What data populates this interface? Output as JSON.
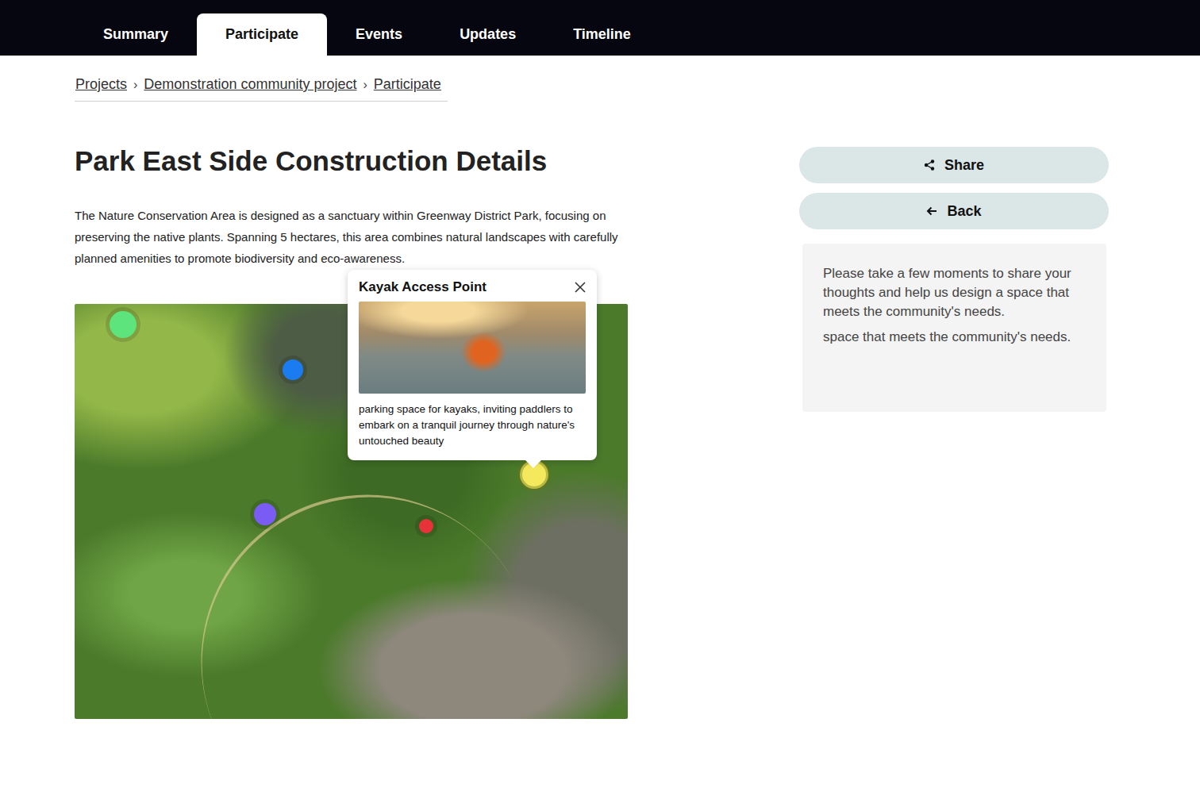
{
  "nav": {
    "tabs": [
      {
        "label": "Summary",
        "selected": false
      },
      {
        "label": "Participate",
        "selected": true
      },
      {
        "label": "Events",
        "selected": false
      },
      {
        "label": "Updates",
        "selected": false
      },
      {
        "label": "Timeline",
        "selected": false
      }
    ]
  },
  "breadcrumb": {
    "items": [
      "Projects",
      "Demonstration community project",
      "Participate"
    ],
    "separator": "›"
  },
  "page": {
    "title": "Park East Side Construction Details",
    "description": "The Nature Conservation Area is designed as a sanctuary within Greenway District Park, focusing on preserving the native plants. Spanning 5 hectares, this area combines natural landscapes with carefully planned amenities to promote biodiversity and eco-awareness."
  },
  "map": {
    "pins": [
      {
        "color": "#5de47c",
        "selected": false
      },
      {
        "color": "#1a7cf0",
        "selected": false
      },
      {
        "color": "#7a5cf5",
        "selected": false
      },
      {
        "color": "#e8323a",
        "selected": false
      },
      {
        "color": "#f4e95c",
        "selected": true
      }
    ],
    "popup": {
      "title": "Kayak Access Point",
      "description": "parking space for kayaks, inviting paddlers to embark on a tranquil journey through nature's untouched beauty"
    }
  },
  "actions": [
    {
      "label": "Share",
      "kind": "share"
    },
    {
      "label": "Back",
      "kind": "back"
    }
  ],
  "info": {
    "paragraphs": [
      "Please take a few moments to share your thoughts and help us design a space that meets the community's needs.",
      "space that meets the community's needs."
    ]
  }
}
